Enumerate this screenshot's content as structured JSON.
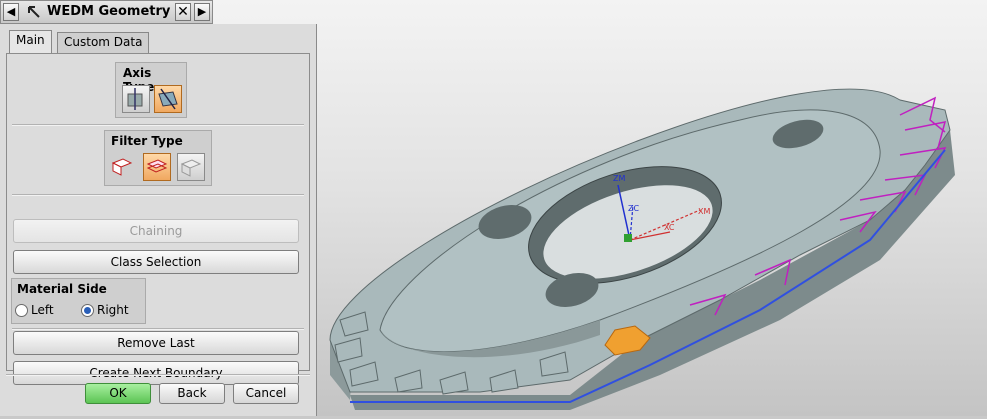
{
  "window": {
    "title": "WEDM Geometry"
  },
  "tabs": [
    {
      "label": "Main"
    },
    {
      "label": "Custom Data"
    }
  ],
  "axis_type": {
    "label": "Axis Type"
  },
  "filter_type": {
    "label": "Filter Type"
  },
  "buttons": {
    "chaining": "Chaining",
    "class_selection": "Class Selection",
    "remove_last": "Remove Last",
    "create_next_boundary": "Create Next Boundary",
    "ok": "OK",
    "back": "Back",
    "cancel": "Cancel"
  },
  "material_side": {
    "label": "Material Side",
    "left": "Left",
    "right": "Right",
    "selected": "Right"
  },
  "axes": {
    "zm": "ZM",
    "zc": "ZC",
    "xc": "XC",
    "xm": "XM"
  },
  "colors": {
    "ok_green": "#5cc454",
    "active_orange": "#f0a860",
    "boundary_magenta": "#c020c0",
    "boundary_blue": "#3050e0",
    "selected_orange": "#f0a030",
    "part_gray": "#a9b9bb"
  }
}
